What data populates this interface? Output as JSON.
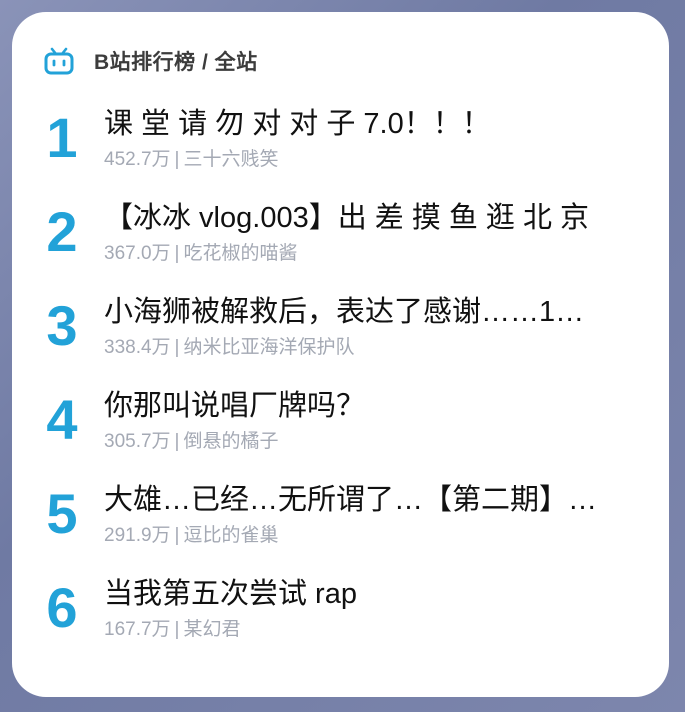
{
  "header": {
    "logo_icon": "bilibili-tv-icon",
    "title": "B站排行榜 / 全站",
    "accent_color": "#22a2d8"
  },
  "ranking": [
    {
      "rank": "1",
      "title": "课 堂 请 勿 对 对 子 7.0！！！",
      "views": "452.7万",
      "author": "三十六贱笑"
    },
    {
      "rank": "2",
      "title": "【冰冰 vlog.003】出 差 摸 鱼 逛 北 京",
      "views": "367.0万",
      "author": "吃花椒的喵酱"
    },
    {
      "rank": "3",
      "title": "小海狮被解救后，表达了感谢……1…",
      "views": "338.4万",
      "author": "纳米比亚海洋保护队"
    },
    {
      "rank": "4",
      "title": "你那叫说唱厂牌吗？",
      "views": "305.7万",
      "author": "倒悬的橘子"
    },
    {
      "rank": "5",
      "title": "大雄…已经…无所谓了…【第二期】…",
      "views": "291.9万",
      "author": "逗比的雀巢"
    },
    {
      "rank": "6",
      "title": "当我第五次尝试 rap",
      "views": "167.7万",
      "author": "某幻君"
    }
  ]
}
